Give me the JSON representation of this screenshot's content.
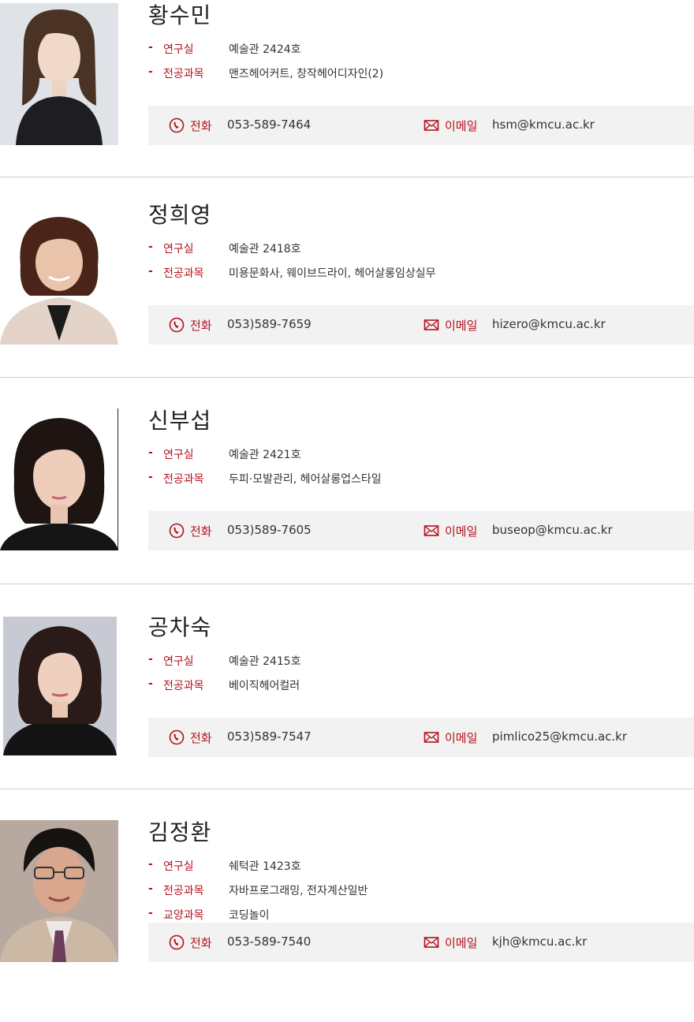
{
  "labels": {
    "office": "연구실",
    "major": "전공과목",
    "general": "교양과목",
    "phone": "전화",
    "email": "이메일"
  },
  "colors": {
    "accent": "#b3121d",
    "contact_bg": "#f2f2f2",
    "divider": "#cfcfcf"
  },
  "professors": [
    {
      "name": "황수민",
      "office": "예술관 2424호",
      "major": "맨즈헤어커트, 창작헤어디자인(2)",
      "phone": "053-589-7464",
      "email": "hsm@kmcu.ac.kr"
    },
    {
      "name": "정희영",
      "office": "예술관 2418호",
      "major": "미용문화사, 웨이브드라이, 헤어살롱임상실무",
      "phone": "053)589-7659",
      "email": "hizero@kmcu.ac.kr"
    },
    {
      "name": "신부섭",
      "office": "예술관 2421호",
      "major": "두피·모발관리, 헤어살롱업스타일",
      "phone": "053)589-7605",
      "email": "buseop@kmcu.ac.kr"
    },
    {
      "name": "공차숙",
      "office": "예술관 2415호",
      "major": "베이직헤어컬러",
      "phone": "053)589-7547",
      "email": "pimlico25@kmcu.ac.kr"
    },
    {
      "name": "김정환",
      "office": "쉐턱관 1423호",
      "major": "자바프로그래밍, 전자계산일반",
      "general": "코딩놀이",
      "phone": "053-589-7540",
      "email": "kjh@kmcu.ac.kr"
    }
  ]
}
